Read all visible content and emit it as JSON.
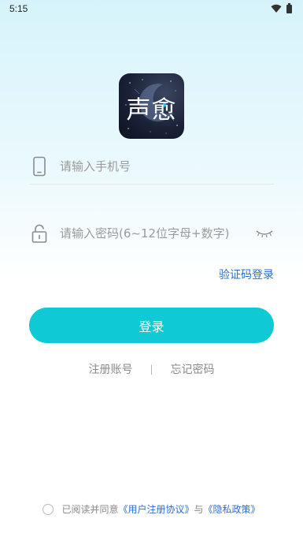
{
  "status_bar": {
    "time": "5:15"
  },
  "logo": {
    "text": "声愈"
  },
  "phone_field": {
    "placeholder": "请输入手机号"
  },
  "password_field": {
    "placeholder": "请输入密码(6~12位字母+数字)"
  },
  "code_login_link": "验证码登录",
  "login_button": "登录",
  "links": {
    "register": "注册账号",
    "separator": "|",
    "forgot": "忘记密码"
  },
  "agreement": {
    "prefix": "已阅读并同意",
    "user_agreement": "《用户注册协议》",
    "conjunction": "与",
    "privacy_policy": "《隐私政策》"
  },
  "colors": {
    "accent": "#0fc9d4",
    "link": "#2c6fd1"
  }
}
